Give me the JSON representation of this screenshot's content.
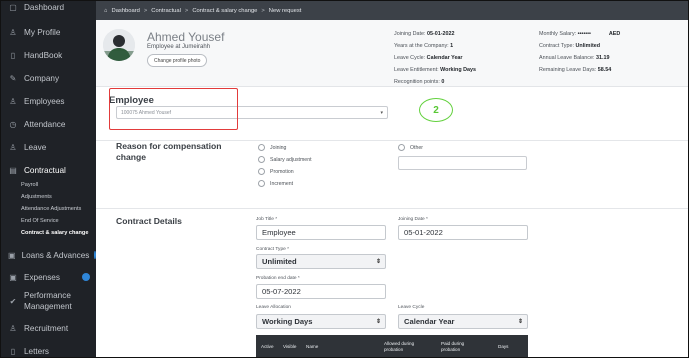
{
  "sidebar": {
    "items": [
      {
        "label": "Dashboard",
        "icon": "dashboard-icon",
        "glyph": "▢"
      },
      {
        "label": "My Profile",
        "icon": "user-icon",
        "glyph": "♙"
      },
      {
        "label": "HandBook",
        "icon": "document-icon",
        "glyph": "▯"
      },
      {
        "label": "Company",
        "icon": "pencil-icon",
        "glyph": "✎"
      },
      {
        "label": "Employees",
        "icon": "users-icon",
        "glyph": "♙"
      },
      {
        "label": "Attendance",
        "icon": "clock-icon",
        "glyph": "◷"
      },
      {
        "label": "Leave",
        "icon": "leave-icon",
        "glyph": "♙"
      },
      {
        "label": "Contractual",
        "icon": "contract-icon",
        "glyph": "▤"
      }
    ],
    "subitems": [
      "Payroll",
      "Adjustments",
      "Attendance Adjustments",
      "End Of Service",
      "Contract & salary change"
    ],
    "items_bottom": [
      {
        "label": "Loans & Advances",
        "icon": "loans-icon",
        "glyph": "▣"
      },
      {
        "label": "Expenses",
        "icon": "expenses-icon",
        "glyph": "▣"
      },
      {
        "label": "Performance",
        "label2": "Management",
        "icon": "performance-icon",
        "glyph": "✔"
      },
      {
        "label": "Recruitment",
        "icon": "recruitment-icon",
        "glyph": "♙"
      },
      {
        "label": "Letters",
        "icon": "letters-icon",
        "glyph": "▯"
      }
    ]
  },
  "breadcrumb": {
    "home_glyph": "⌂",
    "items": [
      "Dashboard",
      "Contractual",
      "Contract & salary change",
      "New request"
    ],
    "sep": ">"
  },
  "profile": {
    "name": "Ahmed Yousef",
    "subtitle": "Employee at Jumeirahh",
    "change_photo": "Change profile photo",
    "info_col1": [
      {
        "k": "Joining Date: ",
        "v": "05-01-2022"
      },
      {
        "k": "Years at the Company: ",
        "v": "1"
      },
      {
        "k": "Leave Cycle: ",
        "v": "Calendar Year"
      },
      {
        "k": "Leave Entitlement: ",
        "v": "Working Days"
      },
      {
        "k": "Recognition points: ",
        "v": "0"
      }
    ],
    "info_col2": [
      {
        "k": "Monthly Salary: ",
        "v": "•••••••",
        "suffix": "AED"
      },
      {
        "k": "Contract Type: ",
        "v": "Unlimited"
      },
      {
        "k": "Annual Leave Balance: ",
        "v": "31.19"
      },
      {
        "k": "Remaining Leave Days: ",
        "v": "58.54"
      }
    ]
  },
  "employee": {
    "title": "Employee",
    "selected": "100075 Ahmed Yousef",
    "caret": "▾",
    "annotation": "2"
  },
  "reason": {
    "title_line1": "Reason for compensation",
    "title_line2": "change",
    "options": [
      "Joining",
      "Salary adjustment",
      "Promotion",
      "Increment"
    ],
    "other_label": "Other"
  },
  "contract": {
    "title": "Contract Details",
    "job_title_label": "Job Title *",
    "job_title_value": "Employee",
    "joining_date_label": "Joining Date *",
    "joining_date_value": "05-01-2022",
    "contract_type_label": "Contract Type *",
    "contract_type_value": "Unlimited",
    "probation_label": "Probation end date *",
    "probation_value": "05-07-2022",
    "leave_allocation_label": "Leave Allocation",
    "leave_allocation_value": "Working Days",
    "leave_cycle_label": "Leave Cycle",
    "leave_cycle_value": "Calendar Year",
    "updown": "⇕",
    "table_headers": [
      "Active",
      "Visible",
      "Name",
      "Allowed during probation",
      "Paid during probation",
      "Days"
    ]
  },
  "colors": {
    "sidebar_bg": "#1f2227",
    "breadcrumb_bg": "#3c4148",
    "annotation_red": "#e23b3b",
    "annotation_green": "#58c834",
    "badge_blue": "#2f86d8"
  }
}
